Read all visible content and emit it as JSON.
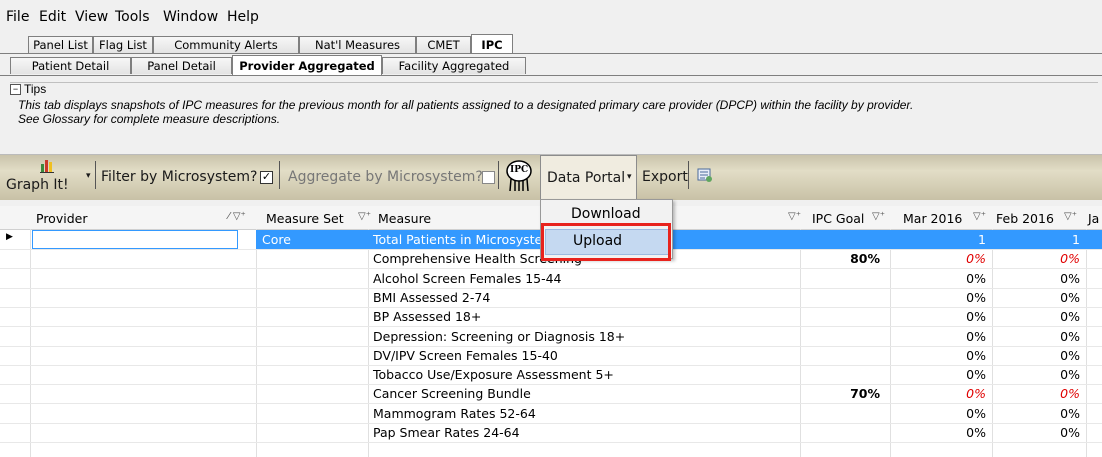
{
  "menubar": [
    "File",
    "Edit",
    "View",
    "Tools",
    "Window",
    "Help"
  ],
  "tabs_top": [
    "Panel List",
    "Flag List",
    "Community Alerts",
    "Nat'l Measures",
    "CMET",
    "IPC"
  ],
  "tabs_top_active": "IPC",
  "tabs_sub": [
    "Patient Detail",
    "Panel Detail",
    "Provider Aggregated",
    "Facility Aggregated"
  ],
  "tabs_sub_active": "Provider Aggregated",
  "tips": {
    "label": "Tips",
    "line1": "This tab displays snapshots of IPC measures for the previous month for all patients assigned to a designated primary care provider (DPCP) within the facility by provider.",
    "line2": "See Glossary for complete measure descriptions."
  },
  "toolbar": {
    "graph_top": "",
    "graph_label": "Graph It!",
    "filter_label": "Filter by Microsystem?",
    "filter_checked": true,
    "aggregate_label": "Aggregate by Microsystem?",
    "aggregate_checked": false,
    "ipc_logo": "IPC",
    "data_portal_label": "Data Portal",
    "export_label": "Export"
  },
  "menu": {
    "items": [
      "Download",
      "Upload"
    ],
    "highlighted": "Upload"
  },
  "grid": {
    "columns": [
      "Provider",
      "Measure Set",
      "Measure",
      "IPC Goal",
      "Mar 2016",
      "Feb 2016",
      "Ja"
    ],
    "rows": [
      {
        "provider": "",
        "set": "Core",
        "measure": "Total Patients in Microsystem",
        "goal": "",
        "mar": "1",
        "feb": "1",
        "selected": true,
        "red": false
      },
      {
        "provider": "",
        "set": "",
        "measure": "Comprehensive Health Screening",
        "goal": "80%",
        "mar": "0%",
        "feb": "0%",
        "selected": false,
        "red": true
      },
      {
        "provider": "",
        "set": "",
        "measure": "Alcohol Screen Females 15-44",
        "goal": "",
        "mar": "0%",
        "feb": "0%",
        "selected": false,
        "red": false
      },
      {
        "provider": "",
        "set": "",
        "measure": "BMI Assessed 2-74",
        "goal": "",
        "mar": "0%",
        "feb": "0%",
        "selected": false,
        "red": false
      },
      {
        "provider": "",
        "set": "",
        "measure": "BP Assessed 18+",
        "goal": "",
        "mar": "0%",
        "feb": "0%",
        "selected": false,
        "red": false
      },
      {
        "provider": "",
        "set": "",
        "measure": "Depression: Screening or Diagnosis 18+",
        "goal": "",
        "mar": "0%",
        "feb": "0%",
        "selected": false,
        "red": false
      },
      {
        "provider": "",
        "set": "",
        "measure": "DV/IPV Screen Females 15-40",
        "goal": "",
        "mar": "0%",
        "feb": "0%",
        "selected": false,
        "red": false
      },
      {
        "provider": "",
        "set": "",
        "measure": "Tobacco Use/Exposure Assessment 5+",
        "goal": "",
        "mar": "0%",
        "feb": "0%",
        "selected": false,
        "red": false
      },
      {
        "provider": "",
        "set": "",
        "measure": "Cancer Screening Bundle",
        "goal": "70%",
        "mar": "0%",
        "feb": "0%",
        "selected": false,
        "red": true
      },
      {
        "provider": "",
        "set": "",
        "measure": "Mammogram Rates 52-64",
        "goal": "",
        "mar": "0%",
        "feb": "0%",
        "selected": false,
        "red": false
      },
      {
        "provider": "",
        "set": "",
        "measure": "Pap Smear Rates 24-64",
        "goal": "",
        "mar": "0%",
        "feb": "0%",
        "selected": false,
        "red": false
      }
    ]
  },
  "colors": {
    "selection": "#3399ff",
    "menu_highlight": "#c5d9f1",
    "callout_border": "#e8231d",
    "missed_goal_text": "#e00000"
  }
}
